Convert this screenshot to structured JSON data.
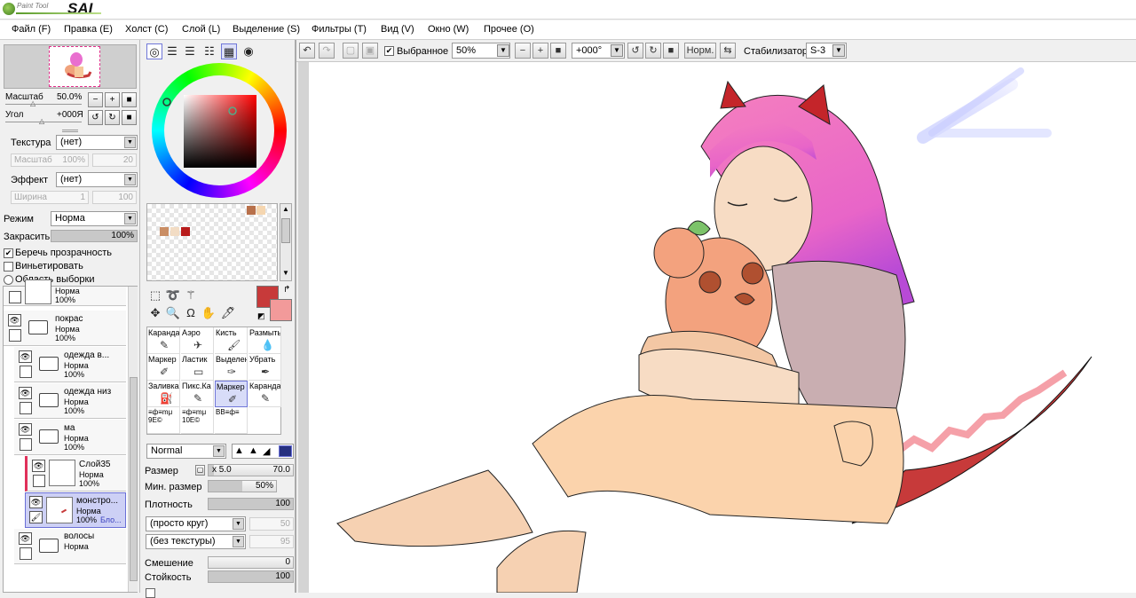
{
  "titlebar": {
    "logo_small": "Paint Tool",
    "logo_big": "SAI"
  },
  "menu": [
    {
      "label": "Файл (F)"
    },
    {
      "label": "Правка (E)"
    },
    {
      "label": "Холст (C)"
    },
    {
      "label": "Слой (L)"
    },
    {
      "label": "Выделение (S)"
    },
    {
      "label": "Фильтры (T)"
    },
    {
      "label": "Вид (V)"
    },
    {
      "label": "Окно (W)"
    },
    {
      "label": "Прочее (O)"
    }
  ],
  "toolbar": {
    "selected_label": "Выбранное",
    "selected_checked": true,
    "zoom": "50%",
    "angle": "+000°",
    "norm_label": "Норм.",
    "stabilizer_label": "Стабилизатор",
    "stabilizer_value": "S-3"
  },
  "navigator": {
    "zoom_label": "Масштаб",
    "zoom_value": "50.0%",
    "angle_label": "Угол",
    "angle_value": "+000Я"
  },
  "texture": {
    "label": "Текстура",
    "value": "(нет)",
    "scale_label": "Масштаб",
    "scale_value": "100%",
    "strength_value": "20"
  },
  "effect": {
    "label": "Эффект",
    "value": "(нет)",
    "width_label": "Ширина",
    "width_value": "1",
    "strength_value": "100"
  },
  "blend": {
    "mode_label": "Режим",
    "mode_value": "Норма",
    "opacity_label": "Закрасить",
    "opacity_value": "100%",
    "opacity_fraction": 1.0
  },
  "options": {
    "preserve_opacity": {
      "label": "Беречь прозрачность",
      "checked": true
    },
    "clipping": {
      "label": "Виньетировать",
      "checked": false
    },
    "selection_source": {
      "label": "Область выборки",
      "checked": false
    }
  },
  "layers": [
    {
      "name": "",
      "mode": "Норма",
      "opacity": "100%",
      "type": "layer"
    },
    {
      "name": "покрас",
      "mode": "Норма",
      "opacity": "100%",
      "type": "folder"
    },
    {
      "name": "одежда в...",
      "mode": "Норма",
      "opacity": "100%",
      "type": "folder"
    },
    {
      "name": "одежда низ",
      "mode": "Норма",
      "opacity": "100%",
      "type": "folder"
    },
    {
      "name": "ма",
      "mode": "Норма",
      "opacity": "100%",
      "type": "folder"
    },
    {
      "name": "Слой35",
      "mode": "Норма",
      "opacity": "100%",
      "type": "layer"
    },
    {
      "name": "монстро...",
      "mode": "Норма",
      "opacity": "100%",
      "extra": "Бло...",
      "type": "layer",
      "selected": true
    },
    {
      "name": "волосы",
      "mode": "Норма",
      "opacity": "",
      "type": "folder"
    }
  ],
  "colors": {
    "primary": "#c73a3a",
    "secondary": "#f29a9a",
    "swatches": [
      "#b8704a",
      "#f5d6b0",
      "#c98d64",
      "#d8b08c",
      "#b81c1c"
    ]
  },
  "brushes": [
    {
      "label": "Каранда",
      "icon": "pencil-icon"
    },
    {
      "label": "Аэро",
      "icon": "airbrush-icon"
    },
    {
      "label": "Кисть",
      "icon": "brush-icon"
    },
    {
      "label": "Размыть",
      "icon": "blur-icon"
    },
    {
      "label": "Маркер",
      "icon": "marker-icon"
    },
    {
      "label": "Ластик",
      "icon": "eraser-icon"
    },
    {
      "label": "Выделен",
      "icon": "select-pen-icon"
    },
    {
      "label": "Убрать",
      "icon": "deselect-icon"
    },
    {
      "label": "Заливка",
      "icon": "bucket-icon"
    },
    {
      "label": "Пикс.Ка",
      "icon": "pixel-pencil-icon"
    },
    {
      "label": "Маркер",
      "icon": "marker-icon",
      "selected": true
    },
    {
      "label": "Каранда",
      "icon": "pencil-icon"
    },
    {
      "label": "≡ф≡mμ 9E©",
      "icon": "custom-icon"
    },
    {
      "label": "≡ф≡mμ 10E©",
      "icon": "custom-icon"
    },
    {
      "label": "BB≡ф≡",
      "icon": "custom-icon"
    }
  ],
  "brush_settings": {
    "mode_value": "Normal",
    "size_label": "Размер",
    "size_mult": "x 5.0",
    "size_value": "70.0",
    "min_size_label": "Мин. размер",
    "min_size_value": "50%",
    "min_size_fraction": 0.5,
    "density_label": "Плотность",
    "density_value": "100",
    "shape_value": "(просто круг)",
    "shape_strength": "50",
    "texture_value": "(без текстуры)",
    "texture_strength": "95",
    "blending_label": "Смешение",
    "blending_value": "0",
    "persistence_label": "Стойкость",
    "persistence_value": "100"
  }
}
